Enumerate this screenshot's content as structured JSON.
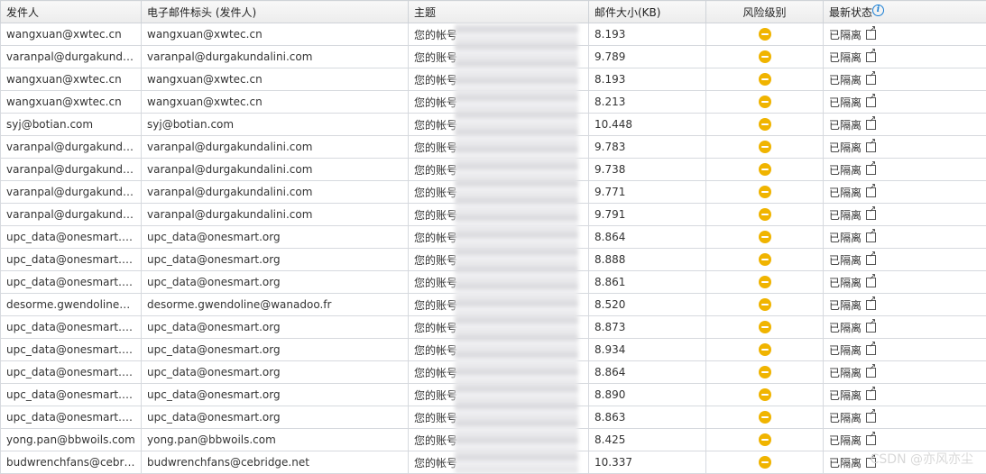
{
  "table": {
    "headers": {
      "sender": "发件人",
      "header_sender": "电子邮件标头 (发件人)",
      "subject": "主题",
      "size": "邮件大小(KB)",
      "risk": "风险级别",
      "status": "最新状态"
    },
    "rows": [
      {
        "sender": "wangxuan@xwtec.cn",
        "header_sender": "wangxuan@xwtec.cn",
        "subject_prefix": "您的帐号",
        "subject_rest": "",
        "size": "8.193",
        "status": "已隔离"
      },
      {
        "sender": "varanpal@durgakundalini.com",
        "header_sender": "varanpal@durgakundalini.com",
        "subject_prefix": "您的账号",
        "subject_rest": "",
        "size": "9.789",
        "status": "已隔离"
      },
      {
        "sender": "wangxuan@xwtec.cn",
        "header_sender": "wangxuan@xwtec.cn",
        "subject_prefix": "您的帐号",
        "subject_rest": "",
        "size": "8.193",
        "status": "已隔离"
      },
      {
        "sender": "wangxuan@xwtec.cn",
        "header_sender": "wangxuan@xwtec.cn",
        "subject_prefix": "您的帐号",
        "subject_rest": "",
        "size": "8.213",
        "status": "已隔离"
      },
      {
        "sender": "syj@botian.com",
        "header_sender": "syj@botian.com",
        "subject_prefix": "您的帐号",
        "subject_rest": "",
        "size": "10.448",
        "status": "已隔离"
      },
      {
        "sender": "varanpal@durgakundalini.com",
        "header_sender": "varanpal@durgakundalini.com",
        "subject_prefix": "您的账号",
        "subject_rest": "",
        "size": "9.783",
        "status": "已隔离"
      },
      {
        "sender": "varanpal@durgakundalini.com",
        "header_sender": "varanpal@durgakundalini.com",
        "subject_prefix": "您的账号",
        "subject_rest": "",
        "size": "9.738",
        "status": "已隔离"
      },
      {
        "sender": "varanpal@durgakundalini.com",
        "header_sender": "varanpal@durgakundalini.com",
        "subject_prefix": "您的账号",
        "subject_rest": "",
        "size": "9.771",
        "status": "已隔离"
      },
      {
        "sender": "varanpal@durgakundalini.com",
        "header_sender": "varanpal@durgakundalini.com",
        "subject_prefix": "您的账号",
        "subject_rest": "",
        "size": "9.791",
        "status": "已隔离"
      },
      {
        "sender": "upc_data@onesmart.org",
        "header_sender": "upc_data@onesmart.org",
        "subject_prefix": "您的帐号",
        "subject_rest": "",
        "size": "8.864",
        "status": "已隔离"
      },
      {
        "sender": "upc_data@onesmart.org",
        "header_sender": "upc_data@onesmart.org",
        "subject_prefix": "您的账号",
        "subject_rest": "",
        "size": "8.888",
        "status": "已隔离"
      },
      {
        "sender": "upc_data@onesmart.org",
        "header_sender": "upc_data@onesmart.org",
        "subject_prefix": "您的账号",
        "subject_rest": "",
        "size": "8.861",
        "status": "已隔离"
      },
      {
        "sender": "desorme.gwendoline@wanadoo.fr",
        "header_sender": "desorme.gwendoline@wanadoo.fr",
        "subject_prefix": "您的账号",
        "subject_rest": "",
        "size": "8.520",
        "status": "已隔离"
      },
      {
        "sender": "upc_data@onesmart.org",
        "header_sender": "upc_data@onesmart.org",
        "subject_prefix": "您的帐号",
        "subject_rest": "",
        "size": "8.873",
        "status": "已隔离"
      },
      {
        "sender": "upc_data@onesmart.org",
        "header_sender": "upc_data@onesmart.org",
        "subject_prefix": "您的帐号",
        "subject_rest": "",
        "size": "8.934",
        "status": "已隔离"
      },
      {
        "sender": "upc_data@onesmart.org",
        "header_sender": "upc_data@onesmart.org",
        "subject_prefix": "您的帐号",
        "subject_rest": "",
        "size": "8.864",
        "status": "已隔离"
      },
      {
        "sender": "upc_data@onesmart.org",
        "header_sender": "upc_data@onesmart.org",
        "subject_prefix": "您的账号",
        "subject_rest": "",
        "size": "8.890",
        "status": "已隔离"
      },
      {
        "sender": "upc_data@onesmart.org",
        "header_sender": "upc_data@onesmart.org",
        "subject_prefix": "您的账号",
        "subject_rest": "",
        "size": "8.863",
        "status": "已隔离"
      },
      {
        "sender": "yong.pan@bbwoils.com",
        "header_sender": "yong.pan@bbwoils.com",
        "subject_prefix": "您的账号",
        "subject_rest": "",
        "size": "8.425",
        "status": "已隔离"
      },
      {
        "sender": "budwrenchfans@cebridge.net",
        "header_sender": "budwrenchfans@cebridge.net",
        "subject_prefix": "您的帐号",
        "subject_rest": "",
        "size": "10.337",
        "status": "已隔离"
      }
    ]
  },
  "risk_color": "#f0b400",
  "info_icon": "info-icon",
  "status_icon": "open-external-icon",
  "watermark": "CSDN @亦风亦尘"
}
